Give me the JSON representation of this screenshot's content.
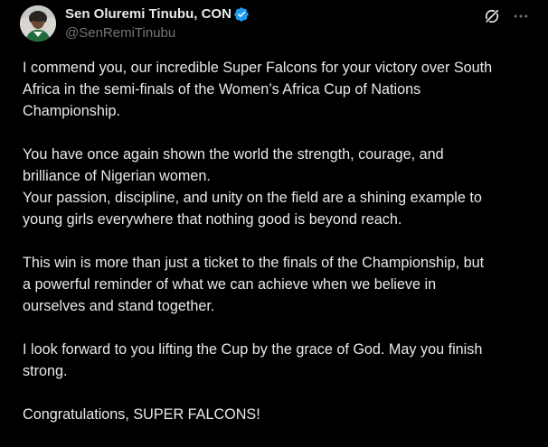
{
  "author": {
    "display_name": "Sen Oluremi Tinubu, CON",
    "handle": "@SenRemiTinubu",
    "avatar_icon": "profile-photo",
    "verified_icon": "verified-badge-icon",
    "verified_color": "#1d9bf0"
  },
  "actions": {
    "grok_icon": "grok-icon",
    "more_icon": "more-horizontal-icon"
  },
  "tweet": {
    "paragraphs": [
      {
        "lines": [
          "I commend you, our incredible Super Falcons for your  victory over South",
          "Africa in the semi-finals of the Women’s Africa Cup of Nations",
          "Championship."
        ]
      },
      {
        "lines": [
          "You have once again shown the world the strength, courage, and",
          "brilliance of Nigerian women.",
          "Your passion, discipline, and unity on the field are a shining example to",
          "young girls everywhere that nothing good is beyond reach."
        ]
      },
      {
        "lines": [
          "This win is more than just a ticket to the finals of the Championship, but",
          "a powerful reminder of what we can achieve when we believe in",
          "ourselves and stand together."
        ]
      },
      {
        "lines": [
          "I look forward to you lifting the Cup by the grace of God. May you finish",
          "strong."
        ]
      },
      {
        "lines": [
          "Congratulations, SUPER FALCONS!"
        ]
      }
    ]
  },
  "colors": {
    "background": "#000000",
    "primary_text": "#e7e9ea",
    "secondary_text": "#71767b"
  }
}
